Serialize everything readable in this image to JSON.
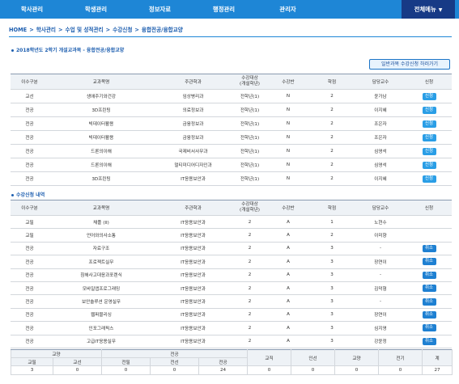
{
  "nav": {
    "items": [
      "학사관리",
      "학생관리",
      "정보자료",
      "행정관리",
      "관리자"
    ],
    "all_menu": "전체메뉴",
    "caret": "▼"
  },
  "breadcrumb": {
    "items": [
      "HOME",
      "학사관리",
      "수업 및 성적관리",
      "수강신청",
      "융합전공/융합교양"
    ],
    "sep": ">"
  },
  "section1": {
    "title": "2018학년도 2학기 개설교과목 - 융합전공/융합교양",
    "apply_button": "일반과목 수강신청 하러가기",
    "headers": [
      "이수구분",
      "교과목명",
      "주관학과",
      "수강대상\n(개설학년)",
      "수강반",
      "학점",
      "담당교수",
      "신청"
    ],
    "rows": [
      [
        "교선",
        "생애주기와건강",
        "임상병리과",
        "전학년(1)",
        "N",
        "2",
        "윤가남",
        "신청"
      ],
      [
        "전공",
        "3D프린팅",
        "의료정보과",
        "전학년(1)",
        "N",
        "2",
        "이지혜",
        "신청"
      ],
      [
        "전공",
        "빅데이터활용",
        "금융정보과",
        "전학년(1)",
        "N",
        "2",
        "조은자",
        "신청"
      ],
      [
        "전공",
        "빅데이터활용",
        "금융정보과",
        "전학년(1)",
        "N",
        "2",
        "조은자",
        "신청"
      ],
      [
        "전공",
        "드론의이해",
        "국제비서사무과",
        "전학년(1)",
        "N",
        "2",
        "심영석",
        "신청"
      ],
      [
        "전공",
        "드론의이해",
        "멀티미디어디자인과",
        "전학년(1)",
        "N",
        "2",
        "심영석",
        "신청"
      ],
      [
        "전공",
        "3D프린팅",
        "IT응용보안과",
        "전학년(1)",
        "N",
        "2",
        "이지혜",
        "신청"
      ]
    ]
  },
  "section2": {
    "title": "수강신청 내역",
    "headers": [
      "이수구분",
      "교과목명",
      "주관학과",
      "수강대상\n(개설학년)",
      "수강반",
      "학점",
      "담당교수",
      "신청"
    ],
    "rows": [
      [
        "교필",
        "채플 (II)",
        "IT응용보안과",
        "2",
        "A",
        "1",
        "노현수",
        ""
      ],
      [
        "교필",
        "언어와의사소통",
        "IT응용보안과",
        "2",
        "A",
        "2",
        "이미향",
        ""
      ],
      [
        "전공",
        "자료구조",
        "IT응용보안과",
        "2",
        "A",
        "3",
        "-",
        "취소"
      ],
      [
        "전공",
        "프로젝트실무",
        "IT응용보안과",
        "2",
        "A",
        "3",
        "장연이",
        "취소"
      ],
      [
        "전공",
        "침해사고대응과포렌식",
        "IT응용보안과",
        "2",
        "A",
        "3",
        "-",
        "취소"
      ],
      [
        "전공",
        "모바일앱프로그래밍",
        "IT응용보안과",
        "2",
        "A",
        "3",
        "김덕형",
        "취소"
      ],
      [
        "전공",
        "보안솔루션 운영실무",
        "IT응용보안과",
        "2",
        "A",
        "3",
        "-",
        "취소"
      ],
      [
        "전공",
        "웹퍼블리싱",
        "IT응용보안과",
        "2",
        "A",
        "3",
        "장연이",
        "취소"
      ],
      [
        "전공",
        "인포그래픽스",
        "IT응용보안과",
        "2",
        "A",
        "3",
        "심지영",
        "취소"
      ],
      [
        "전공",
        "고급IT응용실무",
        "IT응용보안과",
        "2",
        "A",
        "3",
        "강윤정",
        "취소"
      ]
    ]
  },
  "summary": {
    "group_liberal": "교양",
    "group_major": "전공",
    "sub_liberal": [
      "교필",
      "교선"
    ],
    "sub_major": [
      "전필",
      "전선",
      "전공"
    ],
    "others": [
      "교직",
      "인선",
      "교양",
      "전기",
      "계"
    ],
    "values": [
      "3",
      "0",
      "0",
      "0",
      "24",
      "0",
      "0",
      "0",
      "0",
      "27"
    ]
  }
}
